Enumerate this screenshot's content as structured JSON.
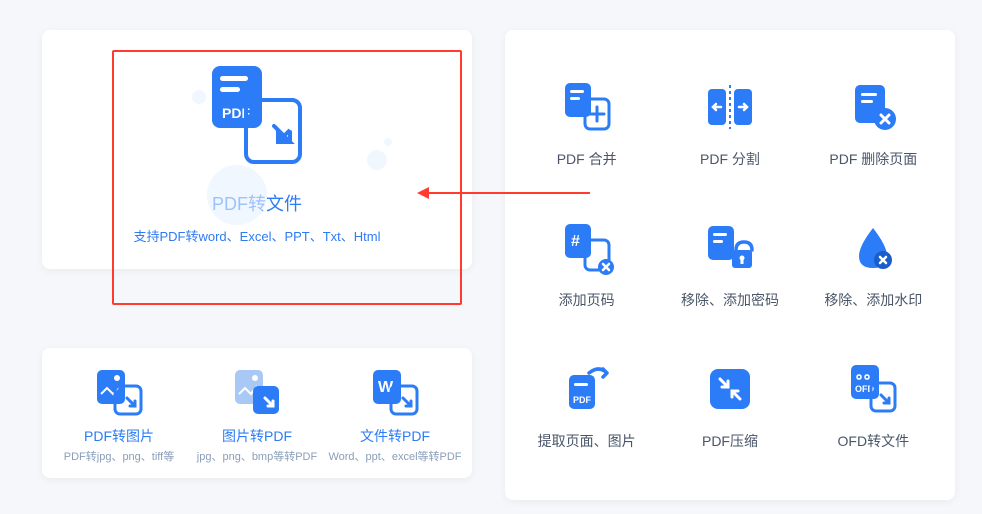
{
  "main_feature": {
    "title": "PDF转文件",
    "desc": "支持PDF转word、Excel、PPT、Txt、Html"
  },
  "small_items": [
    {
      "title": "PDF转图片",
      "desc": "PDF转jpg、png、tiff等"
    },
    {
      "title": "图片转PDF",
      "desc": "jpg、png、bmp等转PDF"
    },
    {
      "title": "文件转PDF",
      "desc": "Word、ppt、excel等转PDF"
    }
  ],
  "grid_items": [
    {
      "label": "PDF 合并"
    },
    {
      "label": "PDF 分割"
    },
    {
      "label": "PDF 删除页面"
    },
    {
      "label": "添加页码"
    },
    {
      "label": "移除、添加密码"
    },
    {
      "label": "移除、添加水印"
    },
    {
      "label": "提取页面、图片"
    },
    {
      "label": "PDF压缩"
    },
    {
      "label": "OFD转文件"
    }
  ]
}
